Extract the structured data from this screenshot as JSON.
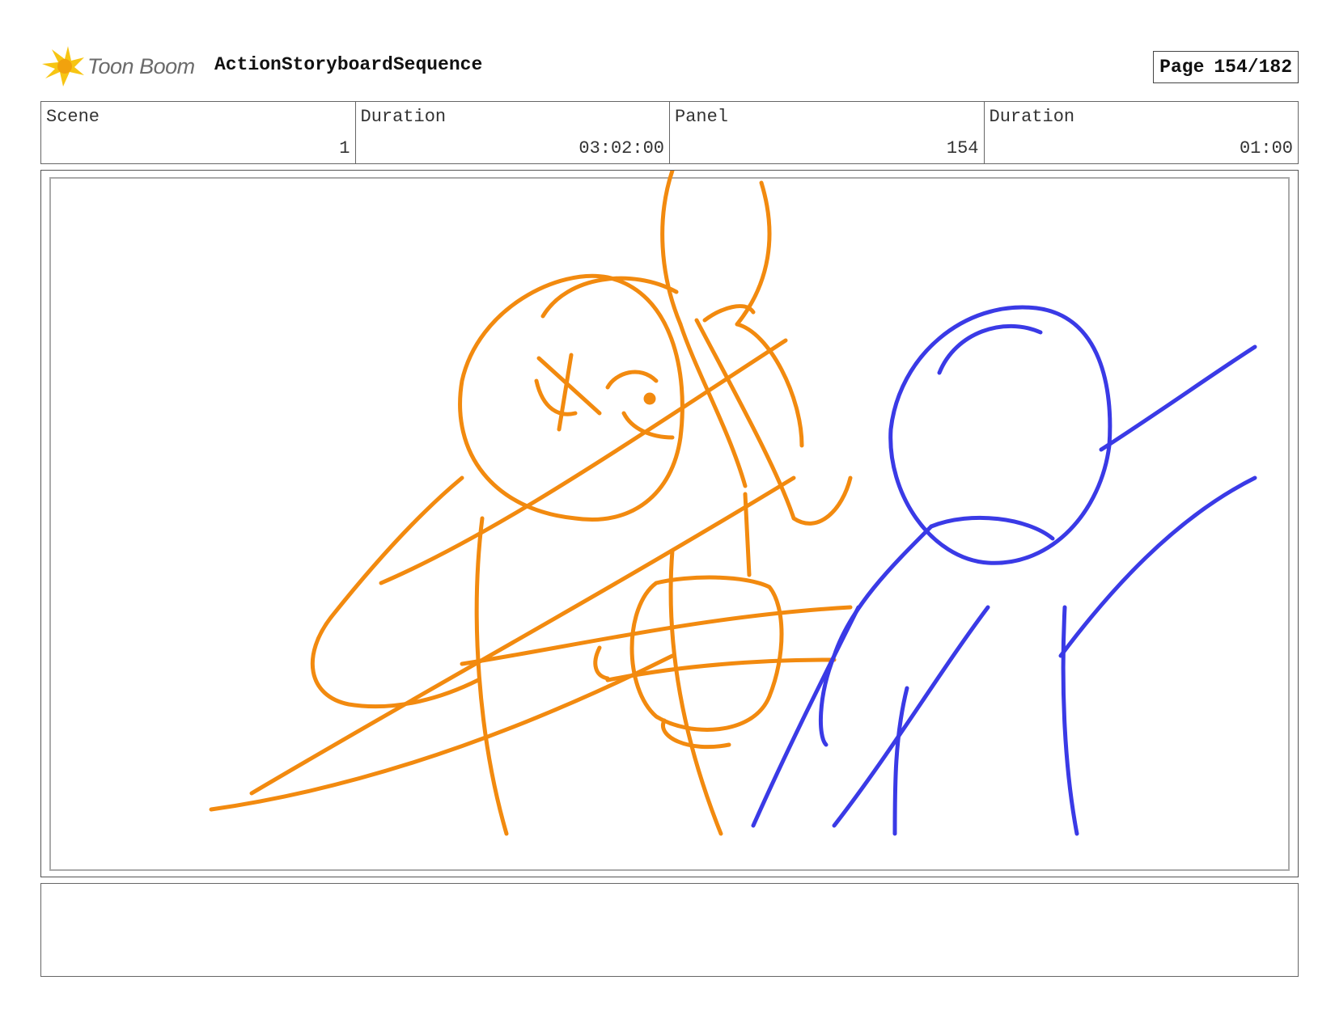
{
  "header": {
    "brand_name": "Toon Boom",
    "project_title": "ActionStoryboardSequence",
    "page_label": "Page",
    "page_value": "154/182"
  },
  "info": [
    {
      "label": "Scene",
      "value": "1"
    },
    {
      "label": "Duration",
      "value": "03:02:00"
    },
    {
      "label": "Panel",
      "value": "154"
    },
    {
      "label": "Duration",
      "value": "01:00"
    }
  ],
  "notes": {
    "text": ""
  },
  "colors": {
    "sketch_orange": "#f28a0f",
    "sketch_blue": "#3a3ae6",
    "logo_yellow": "#f7c513"
  }
}
